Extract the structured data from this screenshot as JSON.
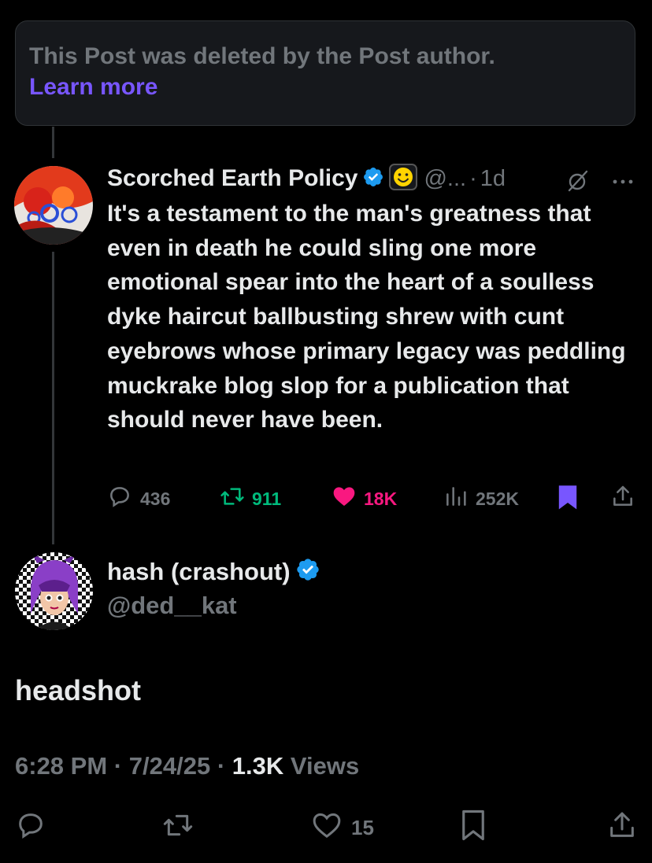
{
  "deleted_notice": {
    "text": "This Post was deleted by the Post author.",
    "link": "Learn more"
  },
  "quoted_post": {
    "author_name": "Scorched Earth Policy",
    "handle": "@...",
    "separator": "·",
    "age": "1d",
    "body": "It's a testament to the man's greatness that even in death he could sling one more emotional spear into the heart of a soulless dyke haircut ballbusting shrew with cunt eyebrows whose primary legacy was peddling muckrake blog slop for a publication that should never have been.",
    "metrics": {
      "replies": "436",
      "reposts": "911",
      "likes": "18K",
      "views": "252K"
    },
    "colors": {
      "repost": "#00ba7c",
      "like": "#f91880",
      "bookmark": "#7856ff"
    }
  },
  "main_post": {
    "author_name": "hash (crashout)",
    "handle": "@ded__kat",
    "text": "headshot",
    "time": "6:28 PM",
    "sep1": "·",
    "date": "7/24/25",
    "sep2": "·",
    "views_count": "1.3K",
    "views_label": "Views",
    "likes": "15"
  },
  "icons": [
    "verified-badge-icon",
    "affiliate-smiley-icon",
    "grok-icon",
    "more-icon",
    "reply-icon",
    "repost-icon",
    "like-icon",
    "views-icon",
    "bookmark-icon",
    "share-icon"
  ],
  "colors": {
    "background": "#000000",
    "secondary_text": "#71767b",
    "verified": "#1d9bf0",
    "link": "#7856ff"
  }
}
